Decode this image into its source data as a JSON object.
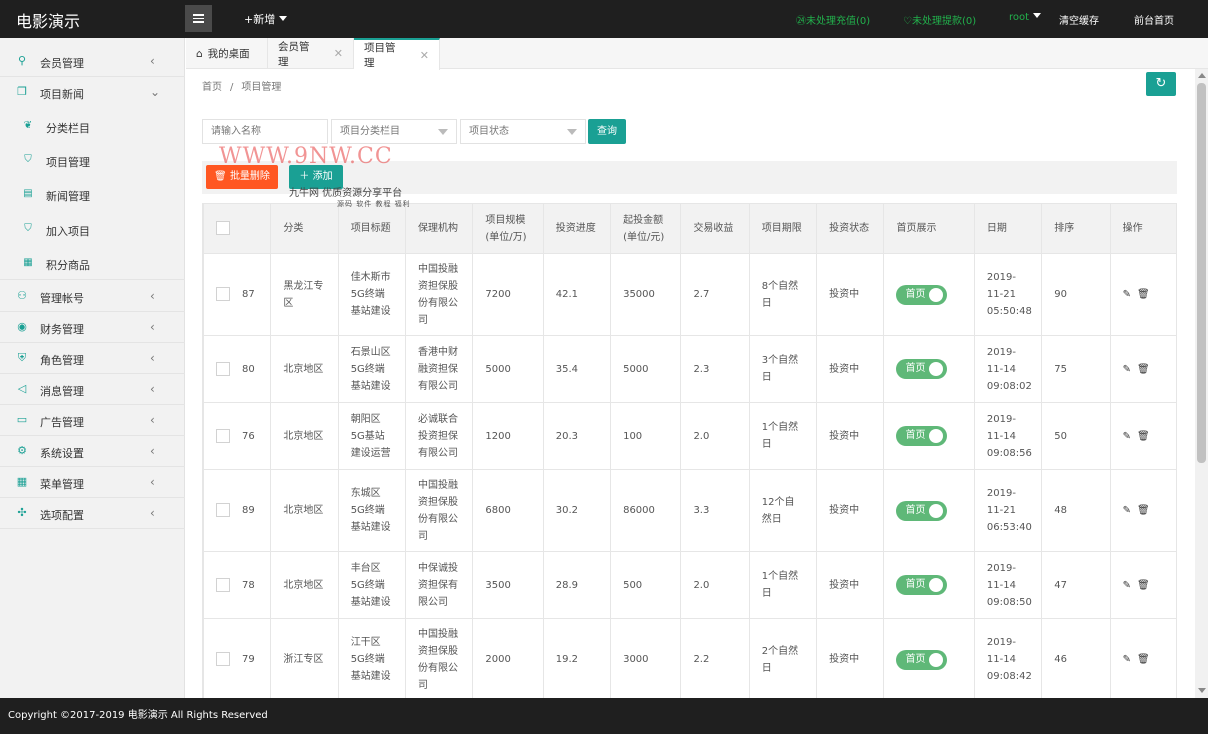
{
  "app": {
    "title": "电影演示"
  },
  "topbar": {
    "add_new": "+新增",
    "pending_recharge": "㉔未处理充值(0)",
    "pending_withdraw": "♡未处理提款(0)",
    "user": "root",
    "clear_cache": "清空缓存",
    "frontend_home": "前台首页",
    "colors": {
      "bg": "#1f1f1f",
      "status_green": "#22b14c",
      "accent": "#1aa094"
    }
  },
  "sidebar": {
    "items": [
      {
        "label": "会员管理",
        "icon": "user-icon"
      },
      {
        "label": "项目新闻",
        "icon": "book-icon"
      },
      {
        "label": "管理帐号",
        "icon": "account-icon"
      },
      {
        "label": "财务管理",
        "icon": "finance-icon"
      },
      {
        "label": "角色管理",
        "icon": "shield-icon"
      },
      {
        "label": "消息管理",
        "icon": "message-icon"
      },
      {
        "label": "广告管理",
        "icon": "ad-icon"
      },
      {
        "label": "系统设置",
        "icon": "gear-icon"
      },
      {
        "label": "菜单管理",
        "icon": "grid-icon"
      },
      {
        "label": "选项配置",
        "icon": "options-icon"
      }
    ],
    "subitems": [
      {
        "label": "分类栏目",
        "icon": "leaf-icon"
      },
      {
        "label": "项目管理",
        "icon": "cart-icon"
      },
      {
        "label": "新闻管理",
        "icon": "news-icon"
      },
      {
        "label": "加入项目",
        "icon": "cart-icon"
      },
      {
        "label": "积分商品",
        "icon": "gift-icon"
      }
    ]
  },
  "tabs": [
    {
      "label": "我的桌面"
    },
    {
      "label": "会员管理"
    },
    {
      "label": "项目管理"
    }
  ],
  "breadcrumb": {
    "home": "首页",
    "sep": "/",
    "current": "项目管理"
  },
  "filters": {
    "name_placeholder": "请输入名称",
    "category": "项目分类栏目",
    "status": "项目状态",
    "search": "查询"
  },
  "toolbar": {
    "batch_delete": "批量删除",
    "add": "添加"
  },
  "watermark": {
    "site": "WWW.9NW.CC",
    "subtitle": "九牛网 优质资源分享平台",
    "tags": "源码 软件 教程 福利"
  },
  "table": {
    "headers": [
      "分类",
      "项目标题",
      "保理机构",
      "项目规模(单位/万)",
      "投资进度",
      "起投金额(单位/元)",
      "交易收益",
      "项目期限",
      "投资状态",
      "首页展示",
      "日期",
      "排序",
      "操作"
    ],
    "rows": [
      {
        "id": "87",
        "category": "黑龙江专区",
        "title": "佳木斯市5G终端基站建设",
        "org": "中国投融资担保股份有限公司",
        "scale": "7200",
        "progress": "42.1",
        "min": "35000",
        "yield": "2.7",
        "term": "8个自然日",
        "status": "投资中",
        "home": "首页",
        "date": "2019-11-21 05:50:48",
        "sort": "90"
      },
      {
        "id": "80",
        "category": "北京地区",
        "title": "石景山区5G终端基站建设",
        "org": "香港中财融资担保有限公司",
        "scale": "5000",
        "progress": "35.4",
        "min": "5000",
        "yield": "2.3",
        "term": "3个自然日",
        "status": "投资中",
        "home": "首页",
        "date": "2019-11-14 09:08:02",
        "sort": "75"
      },
      {
        "id": "76",
        "category": "北京地区",
        "title": "朝阳区5G基站建设运营",
        "org": "必诚联合投资担保有限公司",
        "scale": "1200",
        "progress": "20.3",
        "min": "100",
        "yield": "2.0",
        "term": "1个自然日",
        "status": "投资中",
        "home": "首页",
        "date": "2019-11-14 09:08:56",
        "sort": "50"
      },
      {
        "id": "89",
        "category": "北京地区",
        "title": "东城区5G终端基站建设",
        "org": "中国投融资担保股份有限公司",
        "scale": "6800",
        "progress": "30.2",
        "min": "86000",
        "yield": "3.3",
        "term": "12个自然日",
        "status": "投资中",
        "home": "首页",
        "date": "2019-11-21 06:53:40",
        "sort": "48"
      },
      {
        "id": "78",
        "category": "北京地区",
        "title": "丰台区5G终端基站建设",
        "org": "中保诚投资担保有限公司",
        "scale": "3500",
        "progress": "28.9",
        "min": "500",
        "yield": "2.0",
        "term": "1个自然日",
        "status": "投资中",
        "home": "首页",
        "date": "2019-11-14 09:08:50",
        "sort": "47"
      },
      {
        "id": "79",
        "category": "浙江专区",
        "title": "江干区5G终端基站建设",
        "org": "中国投融资担保股份有限公司",
        "scale": "2000",
        "progress": "19.2",
        "min": "3000",
        "yield": "2.2",
        "term": "2个自然日",
        "status": "投资中",
        "home": "首页",
        "date": "2019-11-14 09:08:42",
        "sort": "46"
      }
    ]
  },
  "footer": {
    "copyright": "Copyright ©2017-2019 电影演示 All Rights Reserved"
  }
}
